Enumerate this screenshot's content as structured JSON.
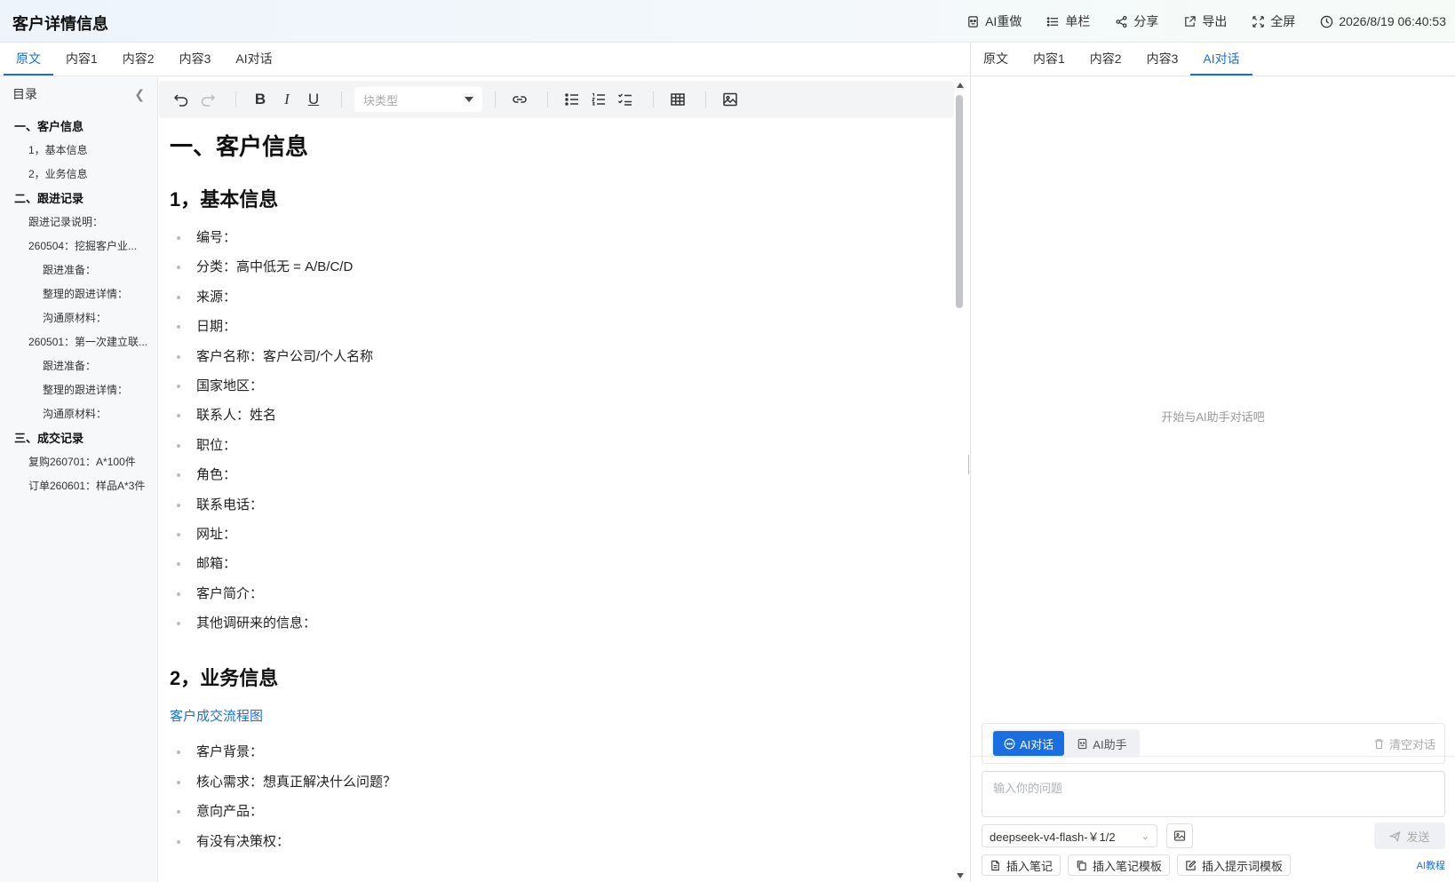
{
  "header": {
    "title": "客户详情信息",
    "actions": {
      "ai_redo": "AI重做",
      "single_column": "单栏",
      "share": "分享",
      "export": "导出",
      "fullscreen": "全屏",
      "datetime": "2026/8/19 06:40:53"
    }
  },
  "left_tabs": [
    "原文",
    "内容1",
    "内容2",
    "内容3",
    "AI对话"
  ],
  "right_tabs": [
    "原文",
    "内容1",
    "内容2",
    "内容3",
    "AI对话"
  ],
  "toc": {
    "title": "目录",
    "items": [
      "一、客户信息",
      "1，基本信息",
      "2，业务信息",
      "二、跟进记录",
      "跟进记录说明：",
      "260504：挖掘客户业...",
      "跟进准备：",
      "整理的跟进详情：",
      "沟通原材料：",
      "260501：第一次建立联...",
      "跟进准备：",
      "整理的跟进详情：",
      "沟通原材料：",
      "三、成交记录",
      "复购260701：A*100件",
      "订单260601：样品A*3件"
    ]
  },
  "toolbar": {
    "bold": "B",
    "italic": "I",
    "underline": "U",
    "block_type_placeholder": "块类型"
  },
  "doc": {
    "h1": "一、客户信息",
    "h2_basic": "1，基本信息",
    "basic_items": [
      "编号：",
      "分类：高中低无 = A/B/C/D",
      "来源：",
      "日期：",
      "客户名称：客户公司/个人名称",
      "国家地区：",
      "联系人：姓名",
      "职位：",
      "角色：",
      "联系电话：",
      "网址：",
      "邮箱：",
      "客户简介：",
      "其他调研来的信息："
    ],
    "h2_business": "2，业务信息",
    "flow_link": "客户成交流程图",
    "business_items": [
      "客户背景：",
      "核心需求：想真正解决什么问题？",
      "意向产品：",
      "有没有决策权："
    ]
  },
  "chat": {
    "empty_hint": "开始与AI助手对话吧",
    "mode_chat": "AI对话",
    "mode_assistant": "AI助手",
    "clear": "清空对话",
    "input_placeholder": "输入你的问题",
    "model": "deepseek-v4-flash-￥1/2",
    "send": "发送",
    "insert_note": "插入笔记",
    "insert_note_template": "插入笔记模板",
    "insert_prompt_template": "插入提示词模板",
    "tutorial": "AI教程"
  },
  "colors": {
    "accent": "#1a6fe0",
    "toc_bg": "#f7f8fa",
    "toolbar_bg": "#f3f4f6"
  }
}
